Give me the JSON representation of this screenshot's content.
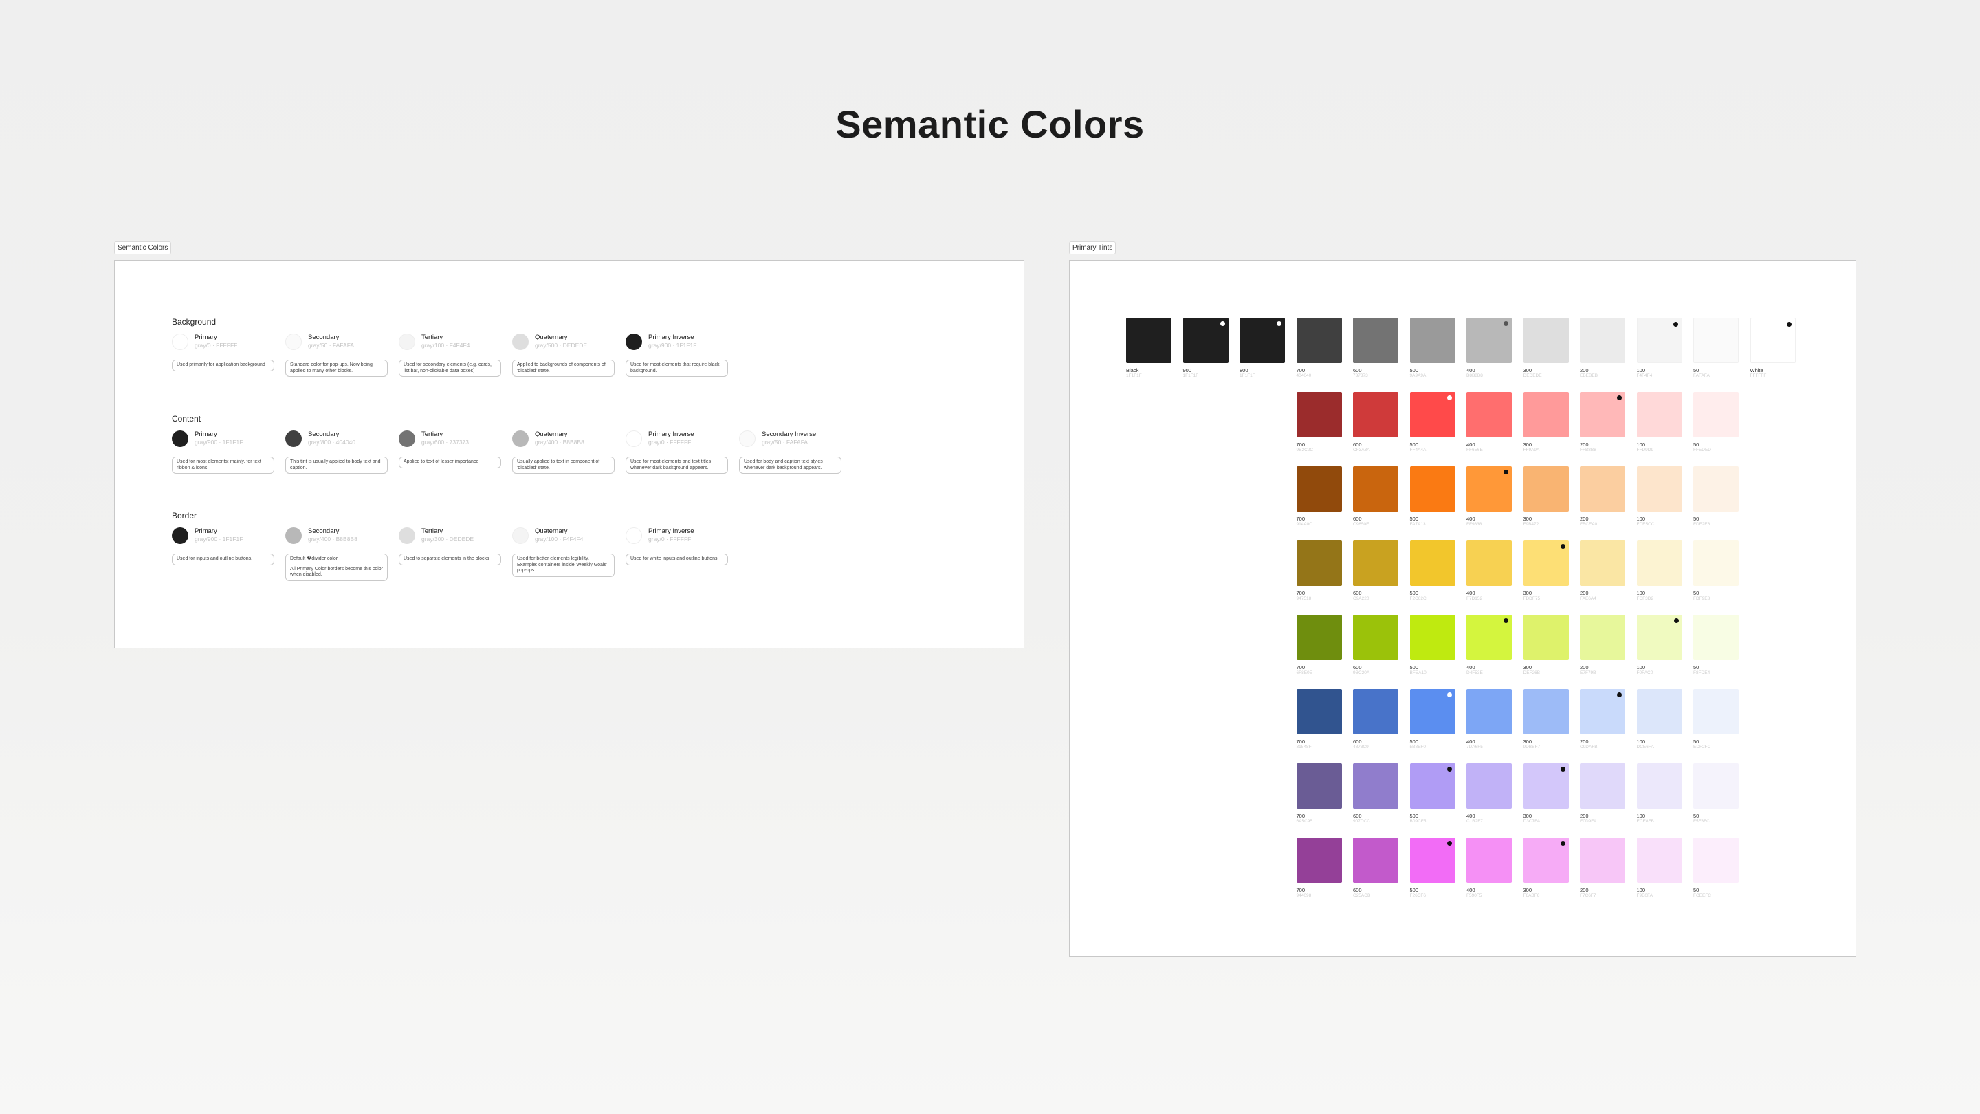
{
  "page": {
    "title": "Semantic Colors"
  },
  "semantic": {
    "frame_label": "Semantic Colors",
    "groups": [
      {
        "title": "Background",
        "tokens": [
          {
            "name": "Primary",
            "code": "gray/0 · FFFFFF",
            "color": "#FFFFFF",
            "desc": "Used primarily for application background"
          },
          {
            "name": "Secondary",
            "code": "gray/50 · FAFAFA",
            "color": "#FAFAFA",
            "desc": "Standard color for pop-ups. Now being applied to many other blocks."
          },
          {
            "name": "Tertiary",
            "code": "gray/100 · F4F4F4",
            "color": "#F4F4F4",
            "desc": "Used for secondary elements (e.g. cards, list bar, non-clickable data boxes)"
          },
          {
            "name": "Quaternary",
            "code": "gray/500 · DEDEDE",
            "color": "#DEDEDE",
            "desc": "Applied to backgrounds of components of 'disabled' state."
          },
          {
            "name": "Primary Inverse",
            "code": "gray/900 · 1F1F1F",
            "color": "#1F1F1F",
            "desc": "Used for most elements that require black background."
          }
        ]
      },
      {
        "title": "Content",
        "tokens": [
          {
            "name": "Primary",
            "code": "gray/900 · 1F1F1F",
            "color": "#1F1F1F",
            "desc": "Used for most elements; mainly, for text ribbon & icons."
          },
          {
            "name": "Secondary",
            "code": "gray/800 · 404040",
            "color": "#404040",
            "desc": "This tint is usually applied to body text and caption."
          },
          {
            "name": "Tertiary",
            "code": "gray/600 · 737373",
            "color": "#737373",
            "desc": "Applied to text of lesser importance"
          },
          {
            "name": "Quaternary",
            "code": "gray/400 · B8B8B8",
            "color": "#B8B8B8",
            "desc": "Usually applied to text in component of 'disabled' state."
          },
          {
            "name": "Primary Inverse",
            "code": "gray/0 · FFFFFF",
            "color": "#FFFFFF",
            "desc": "Used for most elements and text titles whenever dark background appears."
          },
          {
            "name": "Secondary Inverse",
            "code": "gray/50 · FAFAFA",
            "color": "#FAFAFA",
            "desc": "Used for body and caption text styles whenever dark background appears."
          }
        ]
      },
      {
        "title": "Border",
        "tokens": [
          {
            "name": "Primary",
            "code": "gray/900 · 1F1F1F",
            "color": "#1F1F1F",
            "desc": "Used for inputs and outline buttons."
          },
          {
            "name": "Secondary",
            "code": "gray/400 · B8B8B8",
            "color": "#B8B8B8",
            "desc": "Default �divider color.",
            "desc2": "All Primary Color borders become this color when disabled."
          },
          {
            "name": "Tertiary",
            "code": "gray/300 · DEDEDE",
            "color": "#DEDEDE",
            "desc": "Used to separate elements in the blocks"
          },
          {
            "name": "Quaternary",
            "code": "gray/100 · F4F4F4",
            "color": "#F4F4F4",
            "desc": "Used for better elements legibility. Example: containers inside 'Weekly Goals' pop-ups."
          },
          {
            "name": "Primary Inverse",
            "code": "gray/0 · FFFFFF",
            "color": "#FFFFFF",
            "desc": "Used for white inputs and outline buttons."
          }
        ]
      }
    ]
  },
  "tints": {
    "frame_label": "Primary Tints",
    "gray_row": [
      {
        "name": "Black",
        "hex": "1F1F1F",
        "color": "#1F1F1F"
      },
      {
        "name": "900",
        "hex": "1F1F1F",
        "color": "#1F1F1F",
        "dot": "#FFFFFF"
      },
      {
        "name": "800",
        "hex": "1F1F1F",
        "color": "#1F1F1F",
        "dot": "#FFFFFF"
      },
      {
        "name": "700",
        "hex": "404040",
        "color": "#404040"
      },
      {
        "name": "600",
        "hex": "737373",
        "color": "#737373"
      },
      {
        "name": "500",
        "hex": "9A9A9A",
        "color": "#9A9A9A"
      },
      {
        "name": "400",
        "hex": "B8B8B8",
        "color": "#B8B8B8",
        "dot": "#555555"
      },
      {
        "name": "300",
        "hex": "DEDEDE",
        "color": "#DEDEDE"
      },
      {
        "name": "200",
        "hex": "EBEBEB",
        "color": "#EBEBEB"
      },
      {
        "name": "100",
        "hex": "F4F4F4",
        "color": "#F4F4F4",
        "dot": "#111111"
      },
      {
        "name": "50",
        "hex": "FAFAFA",
        "color": "#FAFAFA"
      },
      {
        "name": "White",
        "hex": "FFFFFF",
        "color": "#FFFFFF",
        "dot": "#111111"
      }
    ],
    "color_rows": [
      [
        {
          "name": "700",
          "hex": "9B2C2C",
          "color": "#9B2C2C"
        },
        {
          "name": "600",
          "hex": "CF3A3A",
          "color": "#CF3A3A"
        },
        {
          "name": "500",
          "hex": "FF4A4A",
          "color": "#FF4A4A",
          "dot": "#FFFFFF"
        },
        {
          "name": "400",
          "hex": "FF6E6E",
          "color": "#FF6E6E"
        },
        {
          "name": "300",
          "hex": "FF9A9A",
          "color": "#FF9A9A"
        },
        {
          "name": "200",
          "hex": "FFB8B8",
          "color": "#FFB8B8",
          "dot": "#111111"
        },
        {
          "name": "100",
          "hex": "FFD9D9",
          "color": "#FFD9D9"
        },
        {
          "name": "50",
          "hex": "FFEDED",
          "color": "#FFEDED"
        }
      ],
      [
        {
          "name": "700",
          "hex": "914A0C",
          "color": "#914A0C"
        },
        {
          "name": "600",
          "hex": "C9650E",
          "color": "#C9650E"
        },
        {
          "name": "500",
          "hex": "FA7A13",
          "color": "#FA7A13"
        },
        {
          "name": "400",
          "hex": "FF9838",
          "color": "#FF9838",
          "dot": "#111111"
        },
        {
          "name": "300",
          "hex": "F9B472",
          "color": "#F9B472"
        },
        {
          "name": "200",
          "hex": "FBCEA0",
          "color": "#FBCEA0"
        },
        {
          "name": "100",
          "hex": "FDE5CC",
          "color": "#FDE5CC"
        },
        {
          "name": "50",
          "hex": "FDF2E6",
          "color": "#FDF2E6"
        }
      ],
      [
        {
          "name": "700",
          "hex": "947518",
          "color": "#947518"
        },
        {
          "name": "600",
          "hex": "C9A220",
          "color": "#C9A220"
        },
        {
          "name": "500",
          "hex": "F2C62C",
          "color": "#F2C62C"
        },
        {
          "name": "400",
          "hex": "F7D152",
          "color": "#F7D152"
        },
        {
          "name": "300",
          "hex": "FDDF75",
          "color": "#FDDF75",
          "dot": "#111111"
        },
        {
          "name": "200",
          "hex": "FAE6A4",
          "color": "#FAE6A4"
        },
        {
          "name": "100",
          "hex": "FCF3D2",
          "color": "#FCF3D2"
        },
        {
          "name": "50",
          "hex": "FDF9E8",
          "color": "#FDF9E8"
        }
      ],
      [
        {
          "name": "700",
          "hex": "6F8E0E",
          "color": "#6F8E0E"
        },
        {
          "name": "600",
          "hex": "9BC20A",
          "color": "#9BC20A"
        },
        {
          "name": "500",
          "hex": "BFEA10",
          "color": "#BFEA10"
        },
        {
          "name": "400",
          "hex": "D4F53E",
          "color": "#D4F53E",
          "dot": "#111111"
        },
        {
          "name": "300",
          "hex": "DEF26B",
          "color": "#DEF26B"
        },
        {
          "name": "200",
          "hex": "E7F79B",
          "color": "#E7F79B"
        },
        {
          "name": "100",
          "hex": "F0FAC0",
          "color": "#F0FAC0",
          "dot": "#111111"
        },
        {
          "name": "50",
          "hex": "F8FDE4",
          "color": "#F8FDE4"
        }
      ],
      [
        {
          "name": "700",
          "hex": "31548F",
          "color": "#31548F"
        },
        {
          "name": "600",
          "hex": "4873C9",
          "color": "#4873C9"
        },
        {
          "name": "500",
          "hex": "5B8EF0",
          "color": "#5B8EF0",
          "dot": "#FFFFFF"
        },
        {
          "name": "400",
          "hex": "7DA6F5",
          "color": "#7DA6F5"
        },
        {
          "name": "300",
          "hex": "9DBBF7",
          "color": "#9DBBF7"
        },
        {
          "name": "200",
          "hex": "C9DAFB",
          "color": "#C9DAFB",
          "dot": "#111111"
        },
        {
          "name": "100",
          "hex": "DCE6FA",
          "color": "#DCE6FA"
        },
        {
          "name": "50",
          "hex": "EDF2FC",
          "color": "#EDF2FC"
        }
      ],
      [
        {
          "name": "700",
          "hex": "6A5C95",
          "color": "#6A5C95"
        },
        {
          "name": "600",
          "hex": "907DCC",
          "color": "#907DCC"
        },
        {
          "name": "500",
          "hex": "B09CF5",
          "color": "#B09CF5",
          "dot": "#111111"
        },
        {
          "name": "400",
          "hex": "C1B2F7",
          "color": "#C1B2F7"
        },
        {
          "name": "300",
          "hex": "D3C7FA",
          "color": "#D3C7FA",
          "dot": "#111111"
        },
        {
          "name": "200",
          "hex": "E0D9FA",
          "color": "#E0D9FA"
        },
        {
          "name": "100",
          "hex": "ECE8FB",
          "color": "#ECE8FB"
        },
        {
          "name": "50",
          "hex": "F5F3FC",
          "color": "#F5F3FC"
        }
      ],
      [
        {
          "name": "700",
          "hex": "944098",
          "color": "#944098"
        },
        {
          "name": "600",
          "hex": "C25ACB",
          "color": "#C25ACB"
        },
        {
          "name": "500",
          "hex": "F26CF6",
          "color": "#F26CF6",
          "dot": "#111111"
        },
        {
          "name": "400",
          "hex": "F590F5",
          "color": "#F590F5"
        },
        {
          "name": "300",
          "hex": "F6ABF6",
          "color": "#F6ABF6",
          "dot": "#111111"
        },
        {
          "name": "200",
          "hex": "F7C6F7",
          "color": "#F7C6F7"
        },
        {
          "name": "100",
          "hex": "F9E0FA",
          "color": "#F9E0FA"
        },
        {
          "name": "50",
          "hex": "FCEEFC",
          "color": "#FCEEFC"
        }
      ]
    ]
  }
}
